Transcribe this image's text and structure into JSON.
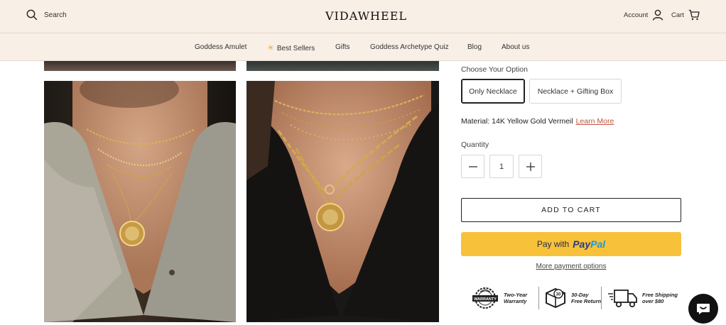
{
  "header": {
    "search_label": "Search",
    "logo_text": "VIDAWHEEL",
    "account_label": "Account",
    "cart_label": "Cart"
  },
  "nav": {
    "items": [
      {
        "label": "Goddess Amulet"
      },
      {
        "label": "Best Sellers",
        "icon": "sun-icon"
      },
      {
        "label": "Gifts"
      },
      {
        "label": "Goddess Archetype Quiz"
      },
      {
        "label": "Blog"
      },
      {
        "label": "About us"
      }
    ]
  },
  "product": {
    "option_label": "Choose Your Option",
    "options": [
      {
        "label": "Only Necklace",
        "selected": true
      },
      {
        "label": "Necklace + Gifting Box",
        "selected": false
      }
    ],
    "material_text": "Material: 14K Yellow Gold Vermeil",
    "learn_more": "Learn More",
    "quantity_label": "Quantity",
    "quantity_value": "1",
    "add_to_cart": "ADD TO CART",
    "paypal_prefix": "Pay with",
    "paypal_brand_a": "Pay",
    "paypal_brand_b": "Pal",
    "more_payment": "More payment options"
  },
  "badges": [
    {
      "icon": "warranty-icon",
      "icon_text": "WARRANTY",
      "line1": "Two-Year",
      "line2": "Warranty"
    },
    {
      "icon": "box-return-icon",
      "icon_text": "30",
      "line1": "30-Day",
      "line2": "Free Return"
    },
    {
      "icon": "truck-icon",
      "line1": "Free Shipping",
      "line2": "over $80"
    }
  ],
  "colors": {
    "header_bg": "#f8efe6",
    "paypal_yellow": "#f8c13a",
    "paypal_dark": "#253b80",
    "paypal_light": "#179bd7",
    "link_red": "#c0543f"
  }
}
